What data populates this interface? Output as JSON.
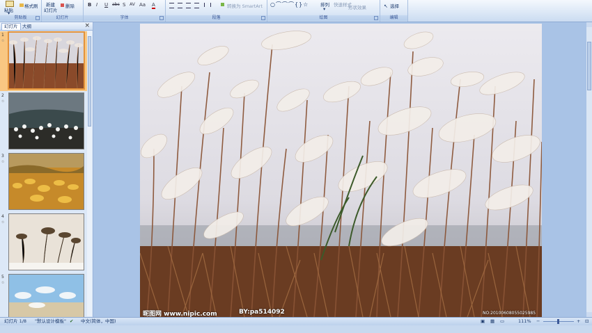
{
  "ribbon": {
    "clipboard": {
      "paste": "粘贴",
      "format_painter": "格式刷",
      "label": "剪贴板"
    },
    "slides": {
      "new_slide": "新建",
      "new_slide2": "幻灯片",
      "delete": "删除",
      "label": "幻灯片"
    },
    "font": {
      "label": "字体",
      "bold": "B",
      "italic": "I",
      "underline": "U",
      "strike": "abc",
      "shadow": "S",
      "spacing": "AV",
      "case": "Aa",
      "color": "A"
    },
    "paragraph": {
      "smartart": "转换为 SmartArt",
      "label": "段落"
    },
    "drawing": {
      "arrange": "排列",
      "quick_styles": "快速样式",
      "shape_effects": "形状效果",
      "label": "绘图"
    },
    "editing": {
      "select": "选择",
      "label": "编辑"
    }
  },
  "pane": {
    "tabs": [
      "幻灯片",
      "大纲"
    ],
    "close": "×",
    "slides": [
      {
        "num": "1"
      },
      {
        "num": "2"
      },
      {
        "num": "3"
      },
      {
        "num": "4"
      },
      {
        "num": "5"
      }
    ]
  },
  "slide": {
    "watermark_left": "昵图网 www.nipic.com",
    "watermark_by": "BY:pa514092",
    "watermark_no": "NO:20100608055025985"
  },
  "status": {
    "slide_count": "幻灯片 1/8",
    "theme": "\"默认设计模板\"",
    "language": "中文(简体，中国)",
    "zoom": "111%"
  },
  "colors": {
    "ribbon_bg": "#dbe7f6",
    "pane_bg": "#dce8f7",
    "editor_bg": "#a9c3e6",
    "selection": "#f9c782"
  }
}
